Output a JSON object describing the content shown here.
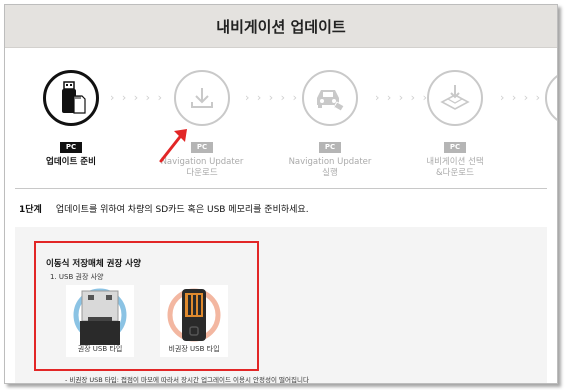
{
  "header": {
    "title": "내비게이션 업데이트"
  },
  "steps": [
    {
      "badge": "PC",
      "label_line1": "업데이트 준비",
      "label_line2": "",
      "icon": "usb-sdcard-icon",
      "active": true
    },
    {
      "badge": "PC",
      "label_line1": "Navigation Updater",
      "label_line2": "다운로드",
      "icon": "download-icon",
      "active": false
    },
    {
      "badge": "PC",
      "label_line1": "Navigation Updater",
      "label_line2": "실행",
      "icon": "car-launch-icon",
      "active": false
    },
    {
      "badge": "PC",
      "label_line1": "내비게이션 선택",
      "label_line2": "&다운로드",
      "icon": "map-download-icon",
      "active": false
    },
    {
      "badge": "PC",
      "label_line1": "업",
      "label_line2": "",
      "icon": "partial-step-icon",
      "active": false
    }
  ],
  "chevrons": "› › › › ›",
  "step_instruction": {
    "number": "1단계",
    "text": "업데이트를 위하여 차량의 SD카드 혹은 USB 메모리를 준비하세요."
  },
  "storage_spec": {
    "heading": "이동식 저장매체 권장 사양",
    "subheading": "1. USB 권장 사양",
    "recommended_caption": "권장 USB 타입",
    "not_recommended_caption": "비권장 USB 타입",
    "note": "- 비권장 USB 타입: 접점이 마모에 따라서 장시간 업그레이드 이용시 안정성이 떨어집니다"
  },
  "colors": {
    "accent_red": "#e22626",
    "active_step": "#111111",
    "inactive_step": "#c9c9c9"
  }
}
